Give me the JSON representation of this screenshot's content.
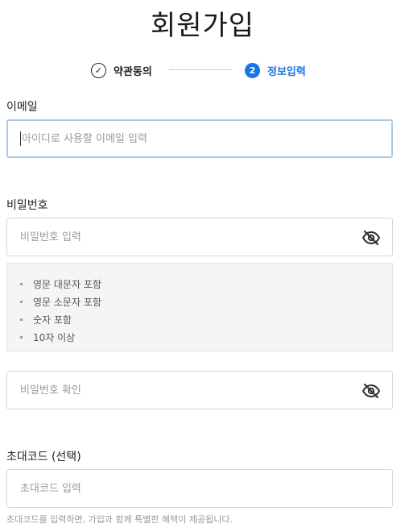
{
  "page": {
    "title": "회원가입"
  },
  "steps": [
    {
      "label": "약관동의",
      "mark": "✓",
      "state": "done"
    },
    {
      "label": "정보입력",
      "mark": "2",
      "state": "active"
    }
  ],
  "email": {
    "label": "이메일",
    "placeholder": "아이디로 사용할 이메일 입력",
    "value": ""
  },
  "password": {
    "label": "비밀번호",
    "placeholder": "비밀번호 입력",
    "value": "",
    "toggle_icon": "eye-slash-icon",
    "rules": [
      "영문 대문자 포함",
      "영문 소문자 포함",
      "숫자 포함",
      "10자 이상"
    ]
  },
  "password_confirm": {
    "placeholder": "비밀번호 확인",
    "value": "",
    "toggle_icon": "eye-slash-icon"
  },
  "invite": {
    "label": "초대코드 (선택)",
    "placeholder": "초대코드 입력",
    "value": "",
    "help": "초대코드를 입력하면, 가입과 함께 특별한 혜택이 제공됩니다."
  },
  "colors": {
    "accent": "#1a73e8",
    "focus_border": "#a9c8ee",
    "rule_box_bg": "#f5f5f5"
  }
}
